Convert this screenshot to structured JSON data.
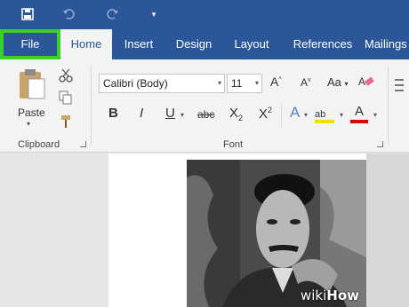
{
  "tabs": {
    "file": "File",
    "home": "Home",
    "insert": "Insert",
    "design": "Design",
    "layout": "Layout",
    "references": "References",
    "mailings": "Mailings"
  },
  "clipboard": {
    "paste_label": "Paste",
    "group_label": "Clipboard"
  },
  "font": {
    "family": "Calibri (Body)",
    "size": "11",
    "group_label": "Font",
    "bold": "B",
    "italic": "I",
    "underline": "U",
    "strike": "abc",
    "subscript": "X",
    "subscript_mark": "2",
    "superscript": "X",
    "superscript_mark": "2",
    "grow": "A",
    "shrink": "A",
    "case": "Aa",
    "text_effects": "A",
    "highlight": "ab",
    "font_color": "A"
  },
  "watermark": {
    "wiki": "wiki",
    "how": "How"
  },
  "colors": {
    "ribbon_blue": "#2b579a",
    "file_highlight": "#3bd128",
    "highlight_yellow": "#f0e000",
    "font_red": "#e00000"
  }
}
